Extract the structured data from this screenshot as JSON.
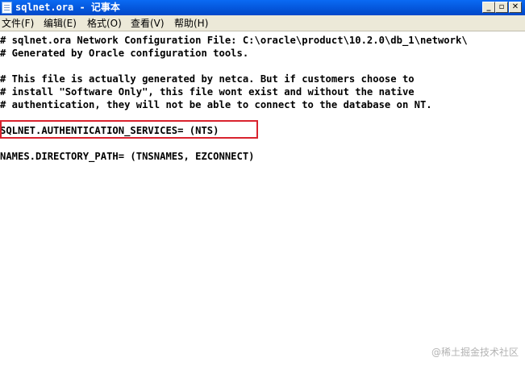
{
  "window": {
    "title": "sqlnet.ora - 记事本",
    "controls": {
      "minimize": "_",
      "restore": "▫",
      "close": "✕"
    }
  },
  "menu": [
    {
      "label": "文件(F)"
    },
    {
      "label": "编辑(E)"
    },
    {
      "label": "格式(O)"
    },
    {
      "label": "查看(V)"
    },
    {
      "label": "帮助(H)"
    }
  ],
  "editor": {
    "lines": [
      "# sqlnet.ora Network Configuration File: C:\\oracle\\product\\10.2.0\\db_1\\network\\",
      "# Generated by Oracle configuration tools.",
      "",
      "# This file is actually generated by netca. But if customers choose to",
      "# install \"Software Only\", this file wont exist and without the native",
      "# authentication, they will not be able to connect to the database on NT.",
      "",
      "SQLNET.AUTHENTICATION_SERVICES= (NTS)",
      "",
      "NAMES.DIRECTORY_PATH= (TNSNAMES, EZCONNECT)"
    ],
    "highlight_color": "#d9232e"
  },
  "watermark": "@稀土掘金技术社区"
}
